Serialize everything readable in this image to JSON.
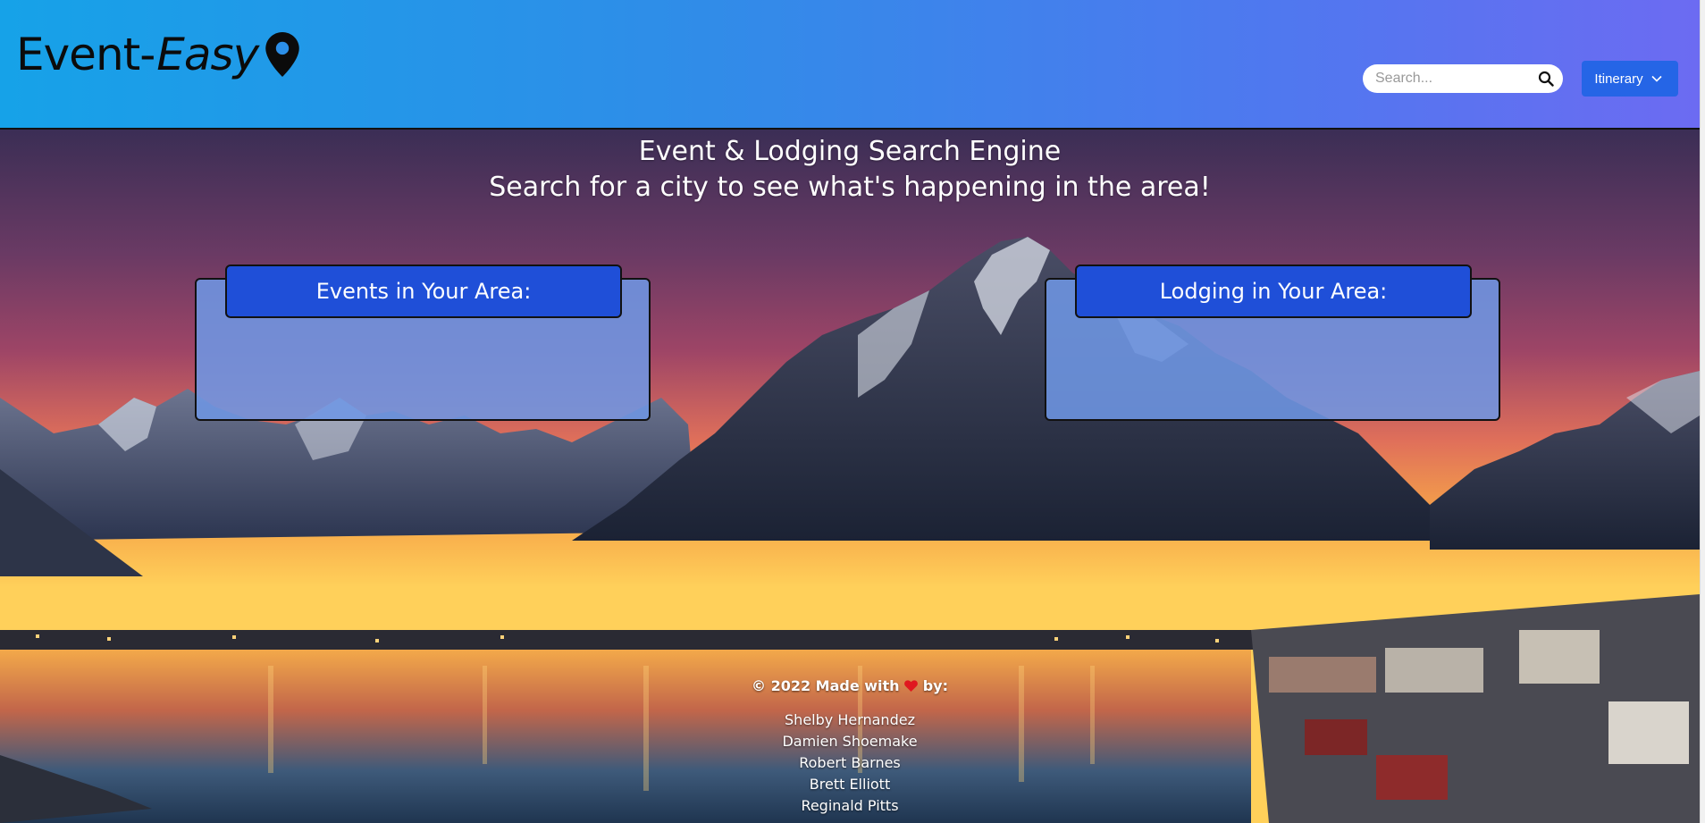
{
  "header": {
    "logo_part1": "Event-",
    "logo_part2": "Easy",
    "logo_icon": "map-pin-icon",
    "search_placeholder": "Search...",
    "search_icon": "search-icon",
    "itinerary_label": "Itinerary",
    "itinerary_icon": "chevron-down-icon"
  },
  "hero": {
    "title": "Event & Lodging Search Engine",
    "subtitle": "Search for a city to see what's happening in the area!"
  },
  "panels": {
    "events_title": "Events in Your Area:",
    "lodging_title": "Lodging in Your Area:"
  },
  "footer": {
    "credit_prefix": "© 2022 Made with ",
    "credit_icon": "heart-icon",
    "credit_suffix": " by:",
    "team": [
      "Shelby Hernandez",
      "Damien Shoemake",
      "Robert Barnes",
      "Brett Elliott",
      "Reginald Pitts"
    ]
  },
  "colors": {
    "header_gradient_start": "#16a2e8",
    "header_gradient_end": "#6c6bf2",
    "button_blue": "#2565e6",
    "panel_title_blue": "#1f4fd8",
    "panel_body": "#6e96e4",
    "heart_red": "#e0181f"
  }
}
